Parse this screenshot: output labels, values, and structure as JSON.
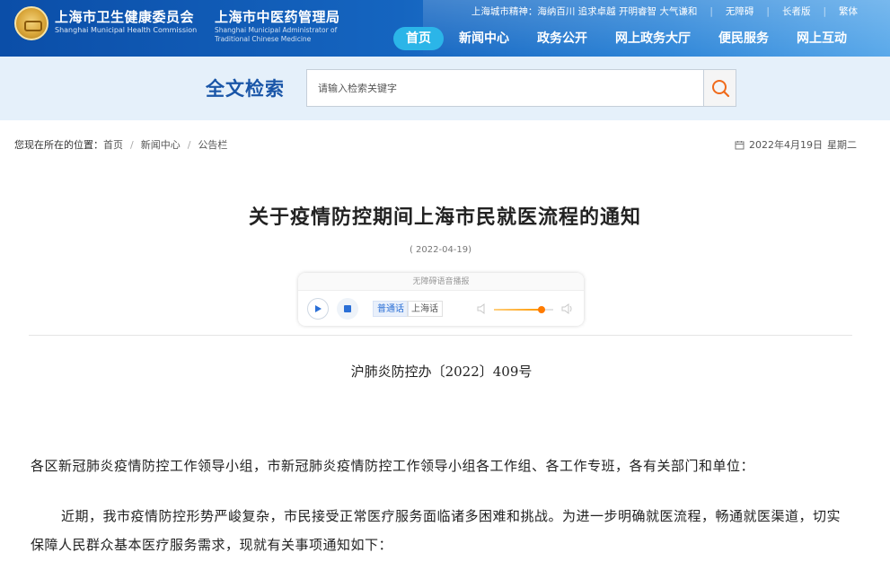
{
  "header": {
    "org1_name": "上海市卫生健康委员会",
    "org1_en": "Shanghai Municipal Health Commission",
    "org2_name": "上海市中医药管理局",
    "org2_en": "Shanghai Municipal Administrator of Traditional Chinese Medicine",
    "city_spirit": "上海城市精神：海纳百川 追求卓越 开明睿智 大气谦和",
    "util_links": [
      "无障碍",
      "长者版",
      "繁体"
    ],
    "nav": [
      "首页",
      "新闻中心",
      "政务公开",
      "网上政务大厅",
      "便民服务",
      "网上互动"
    ],
    "nav_active": "首页",
    "colors": {
      "header_bg": "#1565c0",
      "nav_active_bg": "#2bb5e8"
    }
  },
  "search": {
    "title": "全文检索",
    "placeholder": "请输入检索关键字",
    "button_icon": "search-icon"
  },
  "breadcrumb": {
    "prefix": "您现在所在的位置：",
    "items": [
      "首页",
      "新闻中心",
      "公告栏"
    ],
    "date": "2022年4月19日",
    "weekday": "星期二"
  },
  "article": {
    "title": "关于疫情防控期间上海市民就医流程的通知",
    "date": "( 2022-04-19)",
    "player": {
      "title": "无障碍语音播报",
      "lang_options": [
        "普通话",
        "上海话"
      ],
      "selected_lang": "普通话",
      "volume": 0.8
    },
    "doc_number": "沪肺炎防控办〔2022〕409号",
    "salutation": "各区新冠肺炎疫情防控工作领导小组，市新冠肺炎疫情防控工作领导小组各工作组、各工作专班，各有关部门和单位：",
    "paragraph1": "近期，我市疫情防控形势严峻复杂，市民接受正常医疗服务面临诸多困难和挑战。为进一步明确就医流程，畅通就医渠道，切实保障人民群众基本医疗服务需求，现就有关事项通知如下："
  }
}
